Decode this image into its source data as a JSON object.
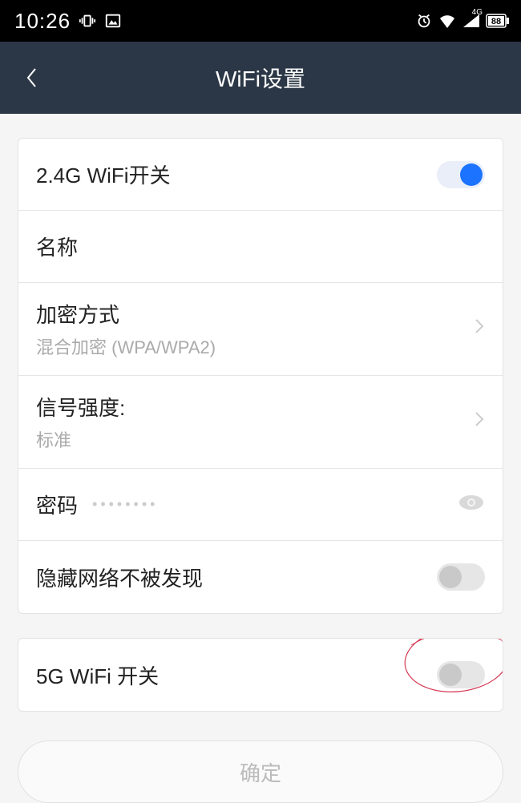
{
  "statusbar": {
    "time": "10:26",
    "network_label": "4G",
    "battery": "88"
  },
  "nav": {
    "title": "WiFi设置"
  },
  "rows": {
    "wifi24_label": "2.4G WiFi开关",
    "name_label": "名称",
    "encryption_label": "加密方式",
    "encryption_value": "混合加密 (WPA/WPA2)",
    "signal_label": "信号强度:",
    "signal_value": "标准",
    "password_label": "密码",
    "password_mask": "••••••••",
    "hide_label": "隐藏网络不被发现",
    "wifi5_label": "5G WiFi 开关"
  },
  "confirm_label": "确定",
  "toggles": {
    "wifi24": true,
    "hide": false,
    "wifi5": false
  }
}
